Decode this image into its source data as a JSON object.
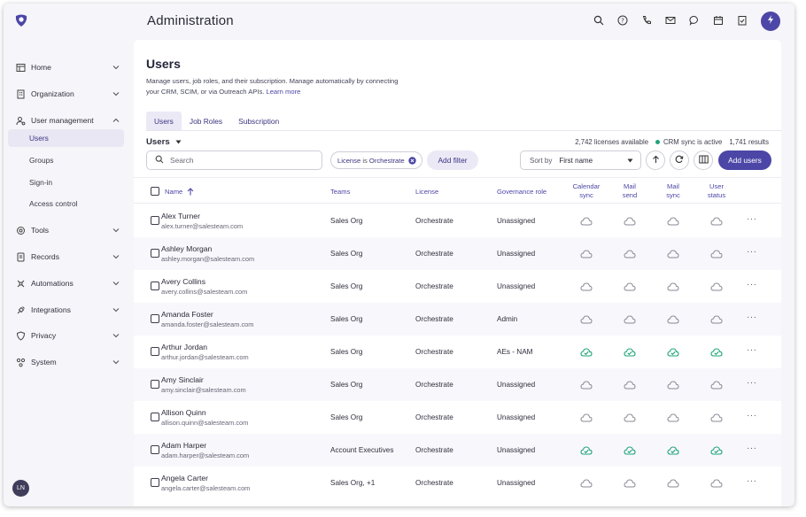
{
  "header": {
    "title": "Administration"
  },
  "sidebar": {
    "items": [
      {
        "label": "Home"
      },
      {
        "label": "Organization"
      },
      {
        "label": "User management"
      },
      {
        "label": "Tools"
      },
      {
        "label": "Records"
      },
      {
        "label": "Automations"
      },
      {
        "label": "Integrations"
      },
      {
        "label": "Privacy"
      },
      {
        "label": "System"
      }
    ],
    "sub_items": [
      {
        "label": "Users"
      },
      {
        "label": "Groups"
      },
      {
        "label": "Sign-in"
      },
      {
        "label": "Access control"
      }
    ],
    "avatar_initials": "LN"
  },
  "page": {
    "title": "Users",
    "description": "Manage users, job roles, and their subscription. Manage automatically by connecting your CRM, SCIM, or via Outreach APIs.",
    "learn_more": "Learn more",
    "tabs": [
      {
        "label": "Users"
      },
      {
        "label": "Job Roles"
      },
      {
        "label": "Subscription"
      }
    ],
    "users_dropdown": "Users",
    "licenses": "2,742 licenses available",
    "crm_sync": "CRM sync is active",
    "results": "1,741 results",
    "search_placeholder": "Search",
    "filter_chip_key": "License",
    "filter_chip_op": "is",
    "filter_chip_value": "Orchestrate",
    "add_filter": "Add filter",
    "sort_by_label": "Sort by",
    "sort_by_value": "First name",
    "add_users": "Add users"
  },
  "colors": {
    "accent": "#4c47a6",
    "success": "#1fa47a"
  },
  "table": {
    "columns": {
      "name": "Name",
      "teams": "Teams",
      "license": "License",
      "governance": "Governance role",
      "calendar_1": "Calendar",
      "calendar_2": "sync",
      "mail_send_1": "Mail",
      "mail_send_2": "send",
      "mail_sync_1": "Mail",
      "mail_sync_2": "sync",
      "user_status_1": "User",
      "user_status_2": "status"
    },
    "rows": [
      {
        "name": "Alex Turner",
        "email": "alex.turner@salesteam.com",
        "teams": "Sales Org",
        "license": "Orchestrate",
        "role": "Unassigned",
        "synced": false
      },
      {
        "name": "Ashley Morgan",
        "email": "ashley.morgan@salesteam.com",
        "teams": "Sales Org",
        "license": "Orchestrate",
        "role": "Unassigned",
        "synced": false
      },
      {
        "name": "Avery Collins",
        "email": "avery.collins@salesteam.com",
        "teams": "Sales Org",
        "license": "Orchestrate",
        "role": "Unassigned",
        "synced": false
      },
      {
        "name": "Amanda Foster",
        "email": "amanda.foster@salesteam.com",
        "teams": "Sales Org",
        "license": "Orchestrate",
        "role": "Admin",
        "synced": false
      },
      {
        "name": "Arthur Jordan",
        "email": "arthur.jordan@salesteam.com",
        "teams": "Sales Org",
        "license": "Orchestrate",
        "role": "AEs - NAM",
        "synced": true
      },
      {
        "name": "Amy Sinclair",
        "email": "amy.sinclair@salesteam.com",
        "teams": "Sales Org",
        "license": "Orchestrate",
        "role": "Unassigned",
        "synced": false
      },
      {
        "name": "Allison Quinn",
        "email": "allison.quinn@salesteam.com",
        "teams": "Sales Org",
        "license": "Orchestrate",
        "role": "Unassigned",
        "synced": false
      },
      {
        "name": "Adam Harper",
        "email": "adam.harper@salesteam.com",
        "teams": "Account Executives",
        "license": "Orchestrate",
        "role": "Unassigned",
        "synced": true
      },
      {
        "name": "Angela Carter",
        "email": "angela.carter@salesteam.com",
        "teams": "Sales Org, +1",
        "license": "Orchestrate",
        "role": "Unassigned",
        "synced": false
      }
    ],
    "more_label": "···"
  }
}
